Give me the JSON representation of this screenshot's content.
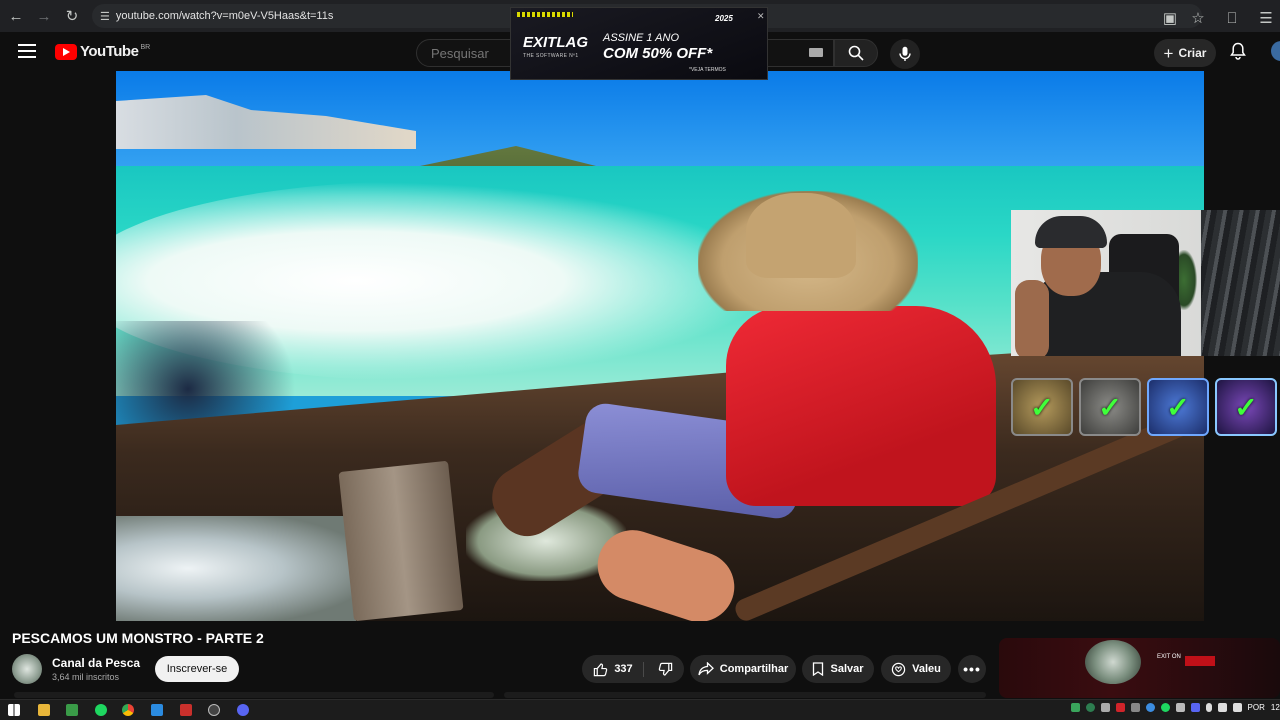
{
  "browser": {
    "url": "youtube.com/watch?v=m0eV-V5Haas&t=11s"
  },
  "header": {
    "logo_text": "YouTube",
    "country_code": "BR",
    "search_placeholder": "Pesquisar",
    "create_label": "Criar"
  },
  "ad": {
    "brand": "EXITLAG",
    "brand_sub": "THE SOFTWARE Nº1",
    "line1": "ASSINE 1 ANO",
    "line2": "COM 50% OFF*",
    "terms": "*VEJA TERMOS",
    "year": "2025"
  },
  "video": {
    "title": "PESCAMOS UM MONSTRO - PARTE 2",
    "channel_name": "Canal da Pesca",
    "subscribers": "3,64 mil inscritos",
    "subscribe_label": "Inscrever-se",
    "like_count": "337",
    "share_label": "Compartilhar",
    "save_label": "Salvar",
    "thanks_label": "Valeu"
  },
  "sidebar_ad": {
    "text": "EXIT ON"
  },
  "taskbar": {
    "language": "POR",
    "clock": "12:"
  }
}
